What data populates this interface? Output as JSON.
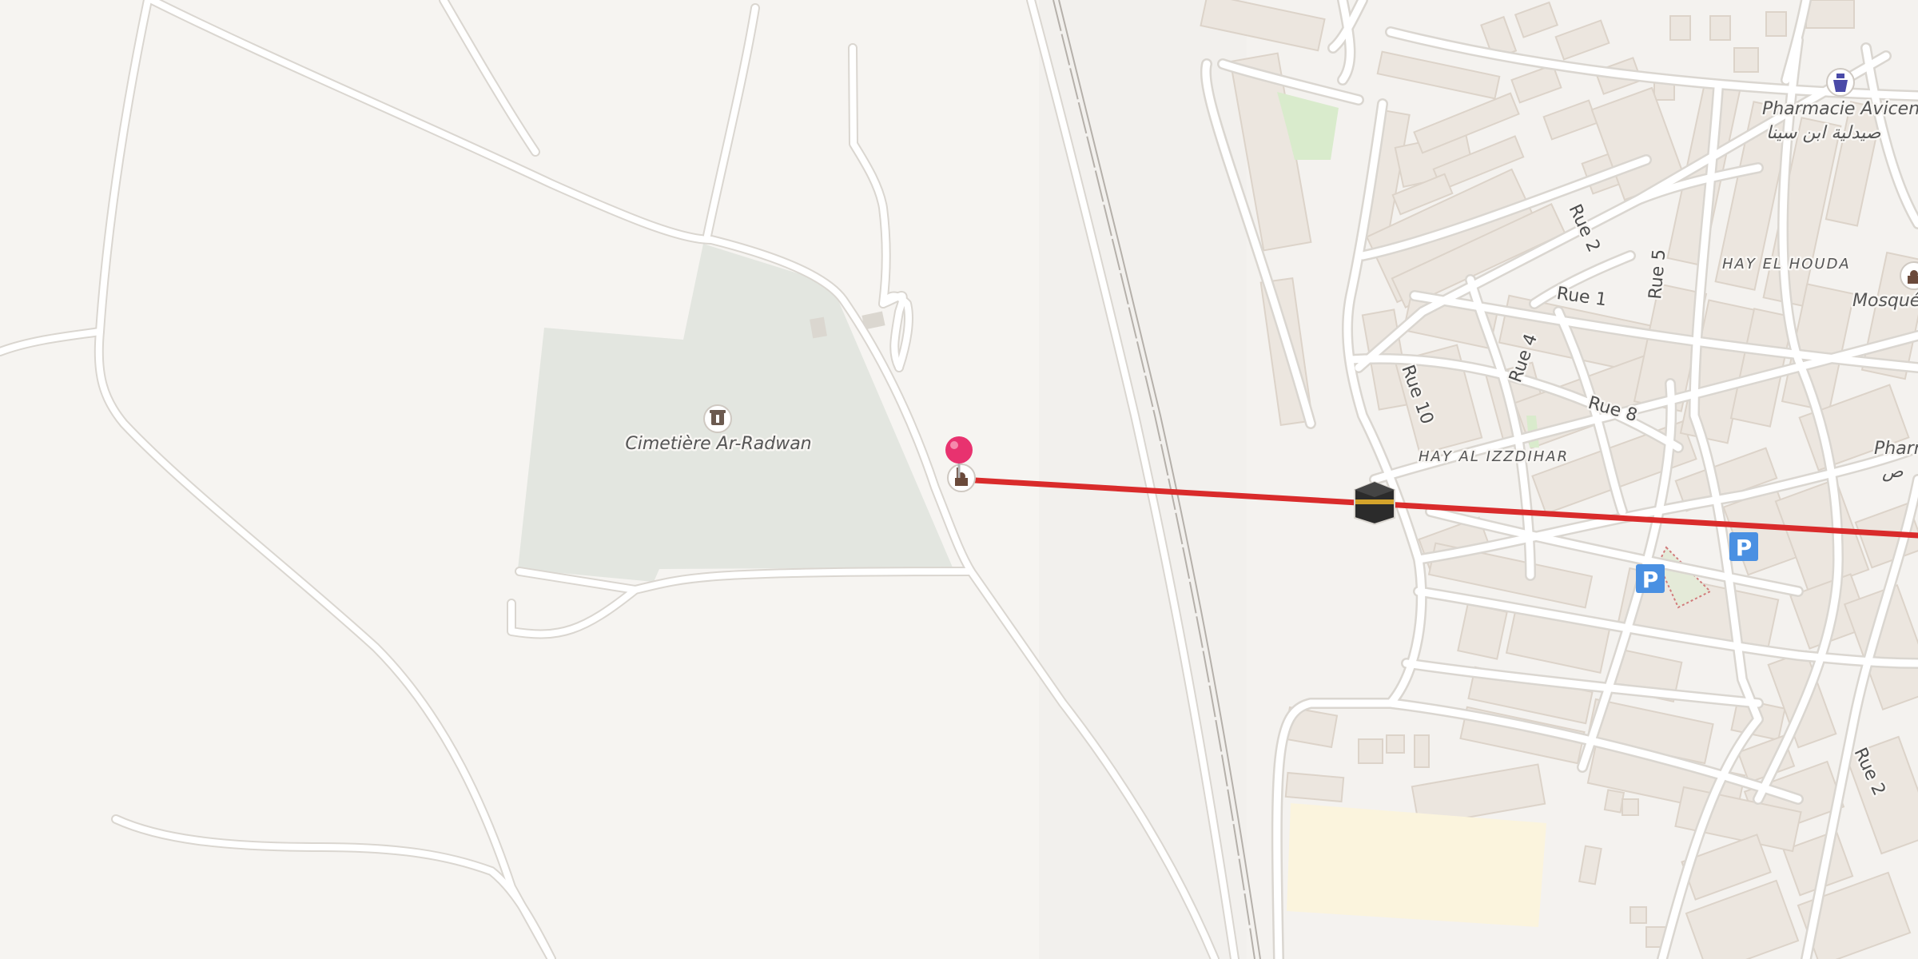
{
  "map": {
    "colors": {
      "background": "#f6f4f1",
      "road": "#ffffff",
      "road_casing": "#dad6d0",
      "building": "#ece6df",
      "building_stroke": "#dcd3c9",
      "cemetery": "#e3e6e0",
      "park": "#d9ebcc",
      "school_area": "#fbf4dd",
      "railway": "#b5b0aa",
      "route_line": "#d92b2b",
      "pin": "#e8326f",
      "parking": "#4a90e2"
    },
    "labels": {
      "cemetery": "Cimetière Ar-Radwan",
      "pharmacy_top_fr": "Pharmacie Avicenne",
      "pharmacy_top_ar": "صيدلية ابن سينا",
      "hay_el_houda": "HAY EL HOUDA",
      "mosque": "Mosquée",
      "pharmacy_right_fr": "Pharm",
      "pharmacy_right_ar": "ص",
      "hay_al_izzdihar": "HAY AL IZZDIHAR",
      "rue_1": "Rue 1",
      "rue_2_top": "Rue 2",
      "rue_4": "Rue 4",
      "rue_5": "Rue 5",
      "rue_8": "Rue 8",
      "rue_10": "Rue 10",
      "rue_2_bottom": "Rue 2",
      "parking_1": "P",
      "parking_2": "P"
    },
    "markers": [
      {
        "name": "location-pin",
        "icon": "pin-icon"
      },
      {
        "name": "mosque-poi",
        "icon": "mosque-icon"
      },
      {
        "name": "kaaba-marker",
        "icon": "kaaba-icon"
      },
      {
        "name": "cemetery-poi",
        "icon": "cemetery-icon"
      },
      {
        "name": "pharmacy-poi",
        "icon": "pharmacy-icon"
      }
    ]
  }
}
